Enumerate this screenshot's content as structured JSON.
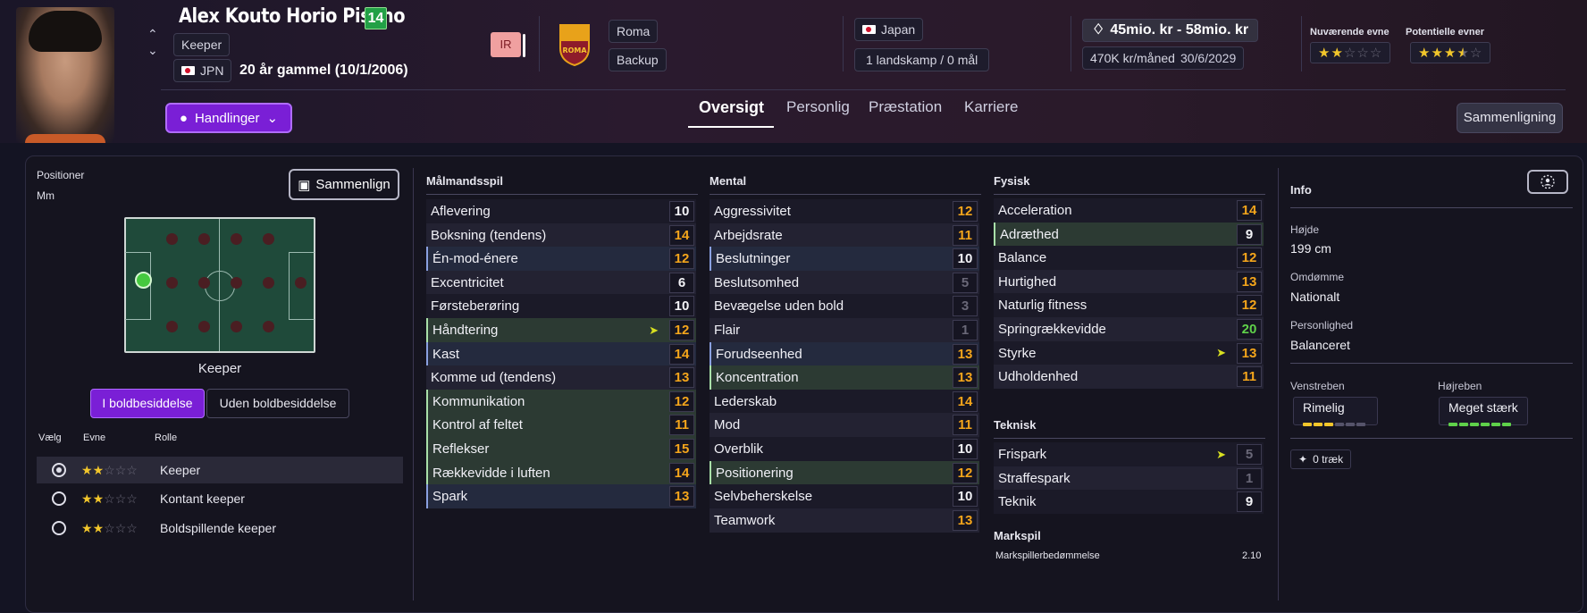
{
  "player": {
    "name": "Alex Kouto Horio Pisano",
    "number": "14",
    "position": "Keeper",
    "nationality_code": "JPN",
    "age_text": "20 år gammel (10/1/2006)",
    "status_badge": "IR"
  },
  "club": {
    "name": "Roma",
    "role": "Backup",
    "crest_text": "ROMA"
  },
  "country": {
    "name": "Japan",
    "caps": "1 landskamp / 0 mål"
  },
  "contract": {
    "value": "45mio. kr - 58mio. kr",
    "wage": "470K kr/måned",
    "expiry": "30/6/2029"
  },
  "ability": {
    "current_label": "Nuværende evne",
    "current_stars": 2.0,
    "potential_label": "Potentielle evner",
    "potential_stars": 3.5
  },
  "actions_label": "Handlinger",
  "tabs": [
    "Oversigt",
    "Personlig",
    "Præstation",
    "Karriere"
  ],
  "compare_label": "Sammenligning",
  "positions": {
    "title": "Positioner",
    "code": "Mm",
    "compare_label": "Sammenlign",
    "pitch_caption": "Keeper",
    "in_possession": "I boldbesiddelse",
    "out_possession": "Uden boldbesiddelse",
    "headers": [
      "Vælg",
      "Evne",
      "Rolle"
    ],
    "roles": [
      {
        "name": "Keeper",
        "stars": 2.0,
        "selected": true
      },
      {
        "name": "Kontant keeper",
        "stars": 2.0,
        "selected": false
      },
      {
        "name": "Boldspillende keeper",
        "stars": 2.0,
        "selected": false
      }
    ]
  },
  "goalkeeping": {
    "title": "Målmandsspil",
    "attributes": [
      {
        "name": "Aflevering",
        "value": "10"
      },
      {
        "name": "Boksning (tendens)",
        "value": "14"
      },
      {
        "name": "Én-mod-énere",
        "value": "12"
      },
      {
        "name": "Excentricitet",
        "value": "6"
      },
      {
        "name": "Førsteberøring",
        "value": "10"
      },
      {
        "name": "Håndtering",
        "value": "12"
      },
      {
        "name": "Kast",
        "value": "14"
      },
      {
        "name": "Komme ud (tendens)",
        "value": "13"
      },
      {
        "name": "Kommunikation",
        "value": "12"
      },
      {
        "name": "Kontrol af feltet",
        "value": "11"
      },
      {
        "name": "Reflekser",
        "value": "15"
      },
      {
        "name": "Rækkevidde i luften",
        "value": "14"
      },
      {
        "name": "Spark",
        "value": "13"
      }
    ]
  },
  "mental": {
    "title": "Mental",
    "attributes": [
      {
        "name": "Aggressivitet",
        "value": "12"
      },
      {
        "name": "Arbejdsrate",
        "value": "11"
      },
      {
        "name": "Beslutninger",
        "value": "10"
      },
      {
        "name": "Beslutsomhed",
        "value": "5"
      },
      {
        "name": "Bevægelse uden bold",
        "value": "3"
      },
      {
        "name": "Flair",
        "value": "1"
      },
      {
        "name": "Forudseenhed",
        "value": "13"
      },
      {
        "name": "Koncentration",
        "value": "13"
      },
      {
        "name": "Lederskab",
        "value": "14"
      },
      {
        "name": "Mod",
        "value": "11"
      },
      {
        "name": "Overblik",
        "value": "10"
      },
      {
        "name": "Positionering",
        "value": "12"
      },
      {
        "name": "Selvbeherskelse",
        "value": "10"
      },
      {
        "name": "Teamwork",
        "value": "13"
      }
    ]
  },
  "physical": {
    "title": "Fysisk",
    "attributes": [
      {
        "name": "Acceleration",
        "value": "14"
      },
      {
        "name": "Adræthed",
        "value": "9"
      },
      {
        "name": "Balance",
        "value": "12"
      },
      {
        "name": "Hurtighed",
        "value": "13"
      },
      {
        "name": "Naturlig fitness",
        "value": "12"
      },
      {
        "name": "Springrækkevidde",
        "value": "20"
      },
      {
        "name": "Styrke",
        "value": "13"
      },
      {
        "name": "Udholdenhed",
        "value": "11"
      }
    ]
  },
  "technical": {
    "title": "Teknisk",
    "attributes": [
      {
        "name": "Frispark",
        "value": "5"
      },
      {
        "name": "Straffespark",
        "value": "1"
      },
      {
        "name": "Teknik",
        "value": "9"
      }
    ]
  },
  "outfield": {
    "title": "Markspil",
    "label": "Markspillerbedømmelse",
    "value": "2.10"
  },
  "info": {
    "title": "Info",
    "height_label": "Højde",
    "height": "199 cm",
    "reputation_label": "Omdømme",
    "reputation": "Nationalt",
    "personality_label": "Personlighed",
    "personality": "Balanceret",
    "left_foot_label": "Venstreben",
    "left_foot": "Rimelig",
    "left_foot_level": 3,
    "right_foot_label": "Højreben",
    "right_foot": "Meget stærk",
    "right_foot_level": 6,
    "traits": "0 træk"
  },
  "colors": {
    "accent": "#7a1fd6",
    "good": "#5fd14a",
    "avg": "#f4a51b",
    "low": "#6a6878"
  }
}
